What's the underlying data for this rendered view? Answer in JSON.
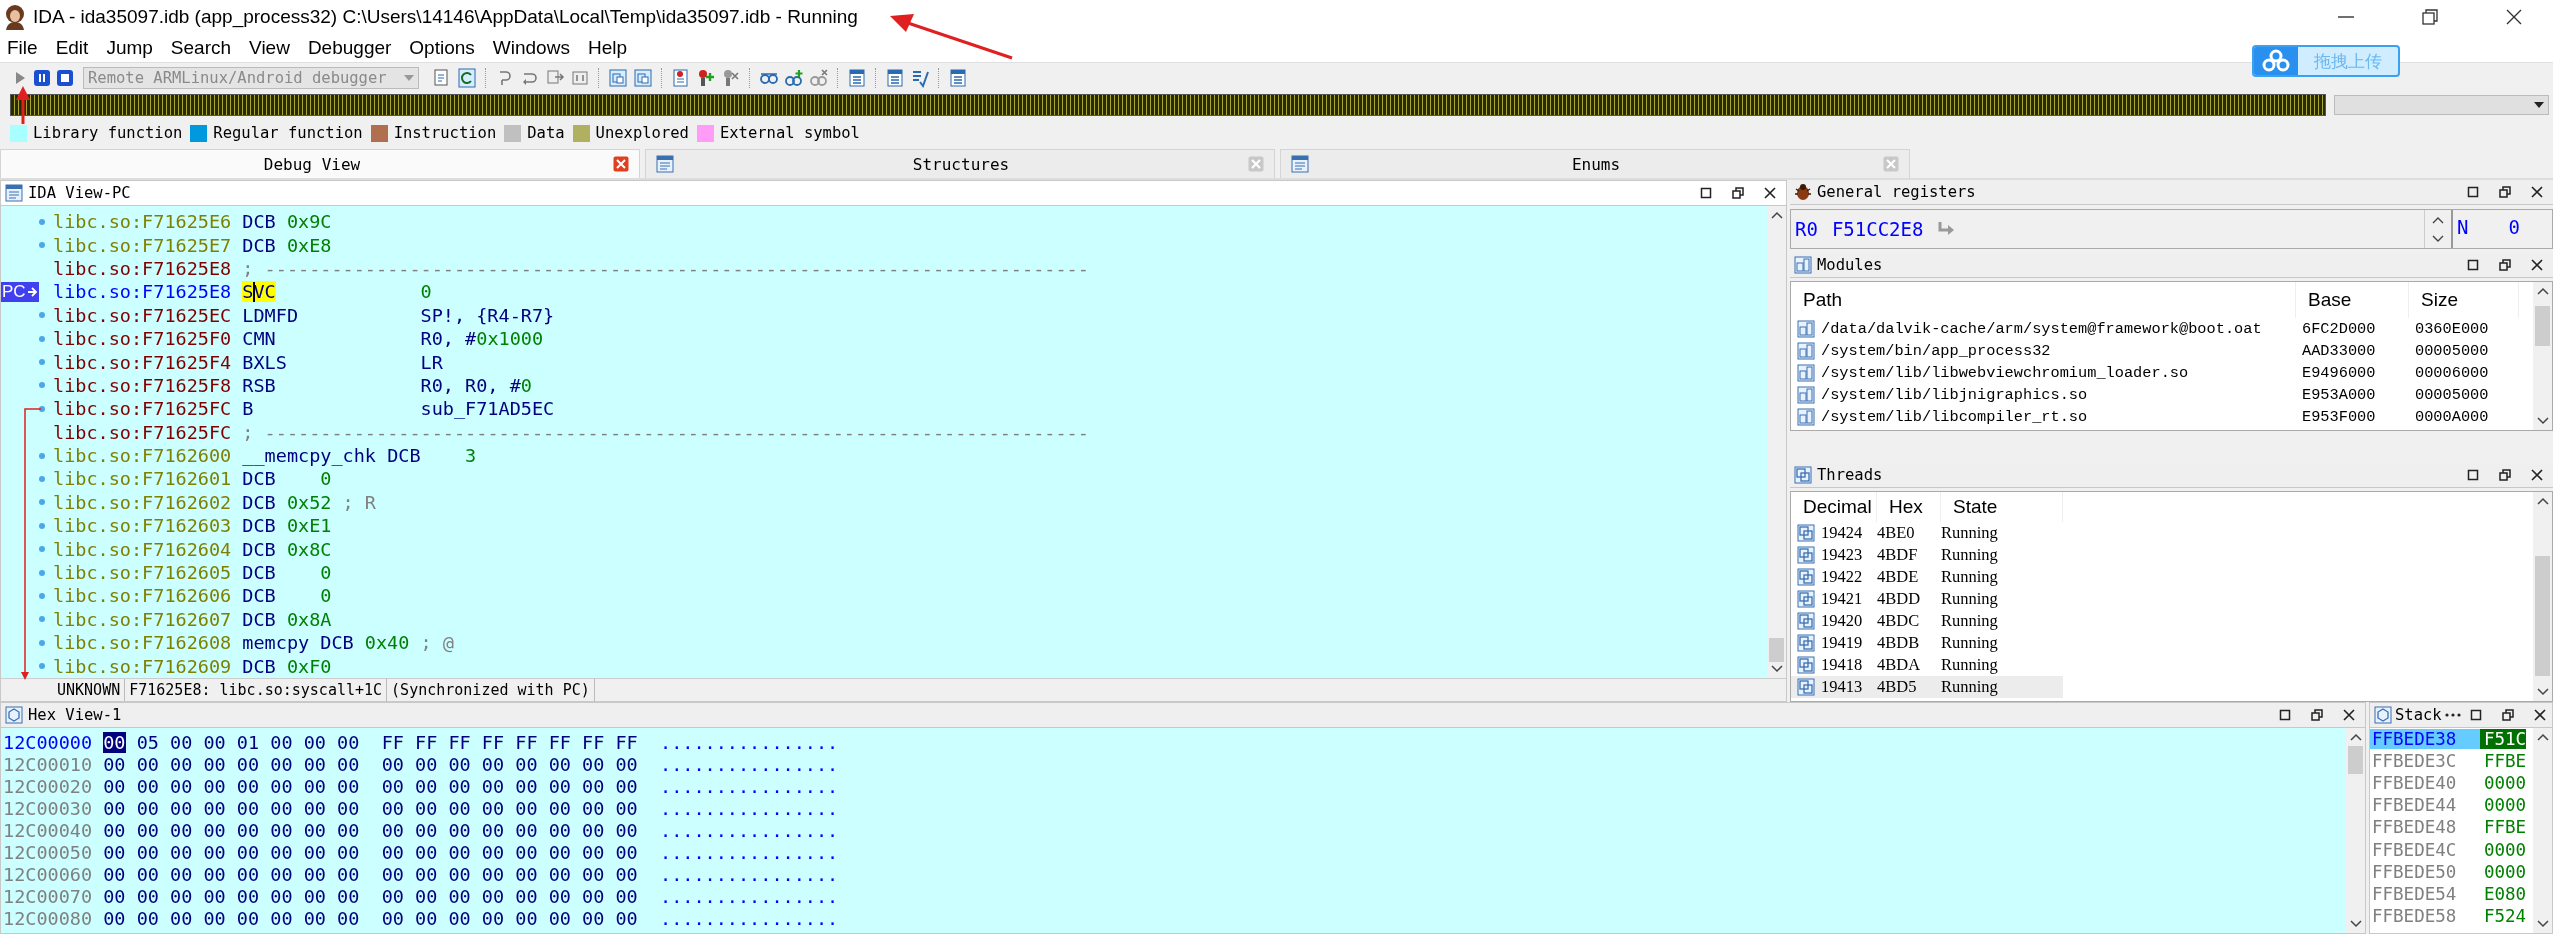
{
  "window": {
    "title": "IDA - ida35097.idb (app_process32) C:\\Users\\14146\\AppData\\Local\\Temp\\ida35097.idb - Running"
  },
  "menu": [
    "File",
    "Edit",
    "Jump",
    "Search",
    "View",
    "Debugger",
    "Options",
    "Windows",
    "Help"
  ],
  "toolbar": {
    "debugger": "Remote ARMLinux/Android debugger"
  },
  "upload_button": {
    "label": "拖拽上传"
  },
  "legend": [
    {
      "label": "Library function",
      "color": "#a8ffff"
    },
    {
      "label": "Regular function",
      "color": "#0099dd"
    },
    {
      "label": "Instruction",
      "color": "#b07050"
    },
    {
      "label": "Data",
      "color": "#c0c0c0"
    },
    {
      "label": "Unexplored",
      "color": "#b0b060"
    },
    {
      "label": "External symbol",
      "color": "#ff9cf8"
    }
  ],
  "tabs": [
    {
      "label": "Debug View",
      "selected": true
    },
    {
      "label": "Structures",
      "selected": false
    },
    {
      "label": "Enums",
      "selected": false
    }
  ],
  "ida_view": {
    "title": "IDA View-PC",
    "pc_label": "PC",
    "lines": [
      {
        "address": "libc.so:F71625E6",
        "kind": "data",
        "current": false,
        "mnemonic": "DCB",
        "value": "0x9C"
      },
      {
        "address": "libc.so:F71625E7",
        "kind": "data",
        "current": false,
        "mnemonic": "DCB",
        "value": "0xE8"
      },
      {
        "address": "libc.so:F71625E8",
        "kind": "separator",
        "current": false,
        "text": "; --------------------------------------------------------------------------"
      },
      {
        "address": "libc.so:F71625E8",
        "kind": "code",
        "current": true,
        "mnemonic": "SVC",
        "number": "0"
      },
      {
        "address": "libc.so:F71625EC",
        "kind": "code",
        "current": false,
        "mnemonic": "LDMFD",
        "operands": "SP!, {R4-R7}"
      },
      {
        "address": "libc.so:F71625F0",
        "kind": "code",
        "current": false,
        "mnemonic": "CMN",
        "operands": "R0, #",
        "number": "0x1000"
      },
      {
        "address": "libc.so:F71625F4",
        "kind": "code",
        "current": false,
        "mnemonic": "BXLS",
        "operands": "LR"
      },
      {
        "address": "libc.so:F71625F8",
        "kind": "code",
        "current": false,
        "mnemonic": "RSB",
        "operands": "R0, R0, #",
        "number": "0"
      },
      {
        "address": "libc.so:F71625FC",
        "kind": "code",
        "current": false,
        "mnemonic": "B",
        "operands": "sub_F71AD5EC"
      },
      {
        "address": "libc.so:F71625FC",
        "kind": "separator",
        "current": false,
        "text": "; --------------------------------------------------------------------------"
      },
      {
        "address": "libc.so:F7162600",
        "kind": "data",
        "current": false,
        "label": "__memcpy_chk",
        "mnemonic": "DCB",
        "value": "3"
      },
      {
        "address": "libc.so:F7162601",
        "kind": "data",
        "current": false,
        "mnemonic": "DCB",
        "value": "0"
      },
      {
        "address": "libc.so:F7162602",
        "kind": "data",
        "current": false,
        "mnemonic": "DCB",
        "value": "0x52",
        "comment": "; R"
      },
      {
        "address": "libc.so:F7162603",
        "kind": "data",
        "current": false,
        "mnemonic": "DCB",
        "value": "0xE1"
      },
      {
        "address": "libc.so:F7162604",
        "kind": "data",
        "current": false,
        "mnemonic": "DCB",
        "value": "0x8C"
      },
      {
        "address": "libc.so:F7162605",
        "kind": "data",
        "current": false,
        "mnemonic": "DCB",
        "value": "0"
      },
      {
        "address": "libc.so:F7162606",
        "kind": "data",
        "current": false,
        "mnemonic": "DCB",
        "value": "0"
      },
      {
        "address": "libc.so:F7162607",
        "kind": "data",
        "current": false,
        "mnemonic": "DCB",
        "value": "0x8A"
      },
      {
        "address": "libc.so:F7162608",
        "kind": "data",
        "current": false,
        "label": "memcpy",
        "mnemonic": "DCB",
        "value": "0x40",
        "comment": "; @"
      },
      {
        "address": "libc.so:F7162609",
        "kind": "data",
        "current": false,
        "mnemonic": "DCB",
        "value": "0xF0"
      }
    ],
    "status": [
      "UNKNOWN",
      "F71625E8: libc.so:syscall+1C",
      "(Synchronized with PC)"
    ]
  },
  "registers": {
    "title": "General registers",
    "rows": [
      {
        "name": "R0",
        "value": "F51CC2E8"
      }
    ],
    "flags": [
      {
        "name": "N",
        "value": "0"
      }
    ]
  },
  "modules": {
    "title": "Modules",
    "columns": [
      "Path",
      "Base",
      "Size"
    ],
    "rows": [
      {
        "path": "/data/dalvik-cache/arm/system@framework@boot.oat",
        "base": "6FC2D000",
        "size": "0360E000"
      },
      {
        "path": "/system/bin/app_process32",
        "base": "AAD33000",
        "size": "00005000"
      },
      {
        "path": "/system/lib/libwebviewchromium_loader.so",
        "base": "E9496000",
        "size": "00006000"
      },
      {
        "path": "/system/lib/libjnigraphics.so",
        "base": "E953A000",
        "size": "00005000"
      },
      {
        "path": "/system/lib/libcompiler_rt.so",
        "base": "E953F000",
        "size": "0000A000"
      }
    ]
  },
  "threads": {
    "title": "Threads",
    "columns": [
      "Decimal",
      "Hex",
      "State"
    ],
    "rows": [
      {
        "decimal": "19424",
        "hex": "4BE0",
        "state": "Running",
        "selected": false
      },
      {
        "decimal": "19423",
        "hex": "4BDF",
        "state": "Running",
        "selected": false
      },
      {
        "decimal": "19422",
        "hex": "4BDE",
        "state": "Running",
        "selected": false
      },
      {
        "decimal": "19421",
        "hex": "4BDD",
        "state": "Running",
        "selected": false
      },
      {
        "decimal": "19420",
        "hex": "4BDC",
        "state": "Running",
        "selected": false
      },
      {
        "decimal": "19419",
        "hex": "4BDB",
        "state": "Running",
        "selected": false
      },
      {
        "decimal": "19418",
        "hex": "4BDA",
        "state": "Running",
        "selected": false
      },
      {
        "decimal": "19413",
        "hex": "4BD5",
        "state": "Running",
        "selected": true
      }
    ]
  },
  "hex_view": {
    "title": "Hex View-1",
    "rows": [
      {
        "address": "12C00000",
        "current": true,
        "bytes": [
          "00",
          "05",
          "00",
          "00",
          "01",
          "00",
          "00",
          "00",
          "FF",
          "FF",
          "FF",
          "FF",
          "FF",
          "FF",
          "FF",
          "FF"
        ],
        "ascii": "................"
      },
      {
        "address": "12C00010",
        "current": false,
        "bytes": [
          "00",
          "00",
          "00",
          "00",
          "00",
          "00",
          "00",
          "00",
          "00",
          "00",
          "00",
          "00",
          "00",
          "00",
          "00",
          "00"
        ],
        "ascii": "................"
      },
      {
        "address": "12C00020",
        "current": false,
        "bytes": [
          "00",
          "00",
          "00",
          "00",
          "00",
          "00",
          "00",
          "00",
          "00",
          "00",
          "00",
          "00",
          "00",
          "00",
          "00",
          "00"
        ],
        "ascii": "................"
      },
      {
        "address": "12C00030",
        "current": false,
        "bytes": [
          "00",
          "00",
          "00",
          "00",
          "00",
          "00",
          "00",
          "00",
          "00",
          "00",
          "00",
          "00",
          "00",
          "00",
          "00",
          "00"
        ],
        "ascii": "................"
      },
      {
        "address": "12C00040",
        "current": false,
        "bytes": [
          "00",
          "00",
          "00",
          "00",
          "00",
          "00",
          "00",
          "00",
          "00",
          "00",
          "00",
          "00",
          "00",
          "00",
          "00",
          "00"
        ],
        "ascii": "................"
      },
      {
        "address": "12C00050",
        "current": false,
        "bytes": [
          "00",
          "00",
          "00",
          "00",
          "00",
          "00",
          "00",
          "00",
          "00",
          "00",
          "00",
          "00",
          "00",
          "00",
          "00",
          "00"
        ],
        "ascii": "................"
      },
      {
        "address": "12C00060",
        "current": false,
        "bytes": [
          "00",
          "00",
          "00",
          "00",
          "00",
          "00",
          "00",
          "00",
          "00",
          "00",
          "00",
          "00",
          "00",
          "00",
          "00",
          "00"
        ],
        "ascii": "................"
      },
      {
        "address": "12C00070",
        "current": false,
        "bytes": [
          "00",
          "00",
          "00",
          "00",
          "00",
          "00",
          "00",
          "00",
          "00",
          "00",
          "00",
          "00",
          "00",
          "00",
          "00",
          "00"
        ],
        "ascii": "................"
      },
      {
        "address": "12C00080",
        "current": false,
        "bytes": [
          "00",
          "00",
          "00",
          "00",
          "00",
          "00",
          "00",
          "00",
          "00",
          "00",
          "00",
          "00",
          "00",
          "00",
          "00",
          "00"
        ],
        "ascii": "................"
      }
    ]
  },
  "stack": {
    "title": "Stack",
    "rows": [
      {
        "address": "FFBEDE38",
        "value": "F51C",
        "selected": true
      },
      {
        "address": "FFBEDE3C",
        "value": "FFBE",
        "selected": false
      },
      {
        "address": "FFBEDE40",
        "value": "0000",
        "selected": false
      },
      {
        "address": "FFBEDE44",
        "value": "0000",
        "selected": false
      },
      {
        "address": "FFBEDE48",
        "value": "FFBE",
        "selected": false
      },
      {
        "address": "FFBEDE4C",
        "value": "0000",
        "selected": false
      },
      {
        "address": "FFBEDE50",
        "value": "0000",
        "selected": false
      },
      {
        "address": "FFBEDE54",
        "value": "E080",
        "selected": false
      },
      {
        "address": "FFBEDE58",
        "value": "F524",
        "selected": false
      }
    ]
  }
}
